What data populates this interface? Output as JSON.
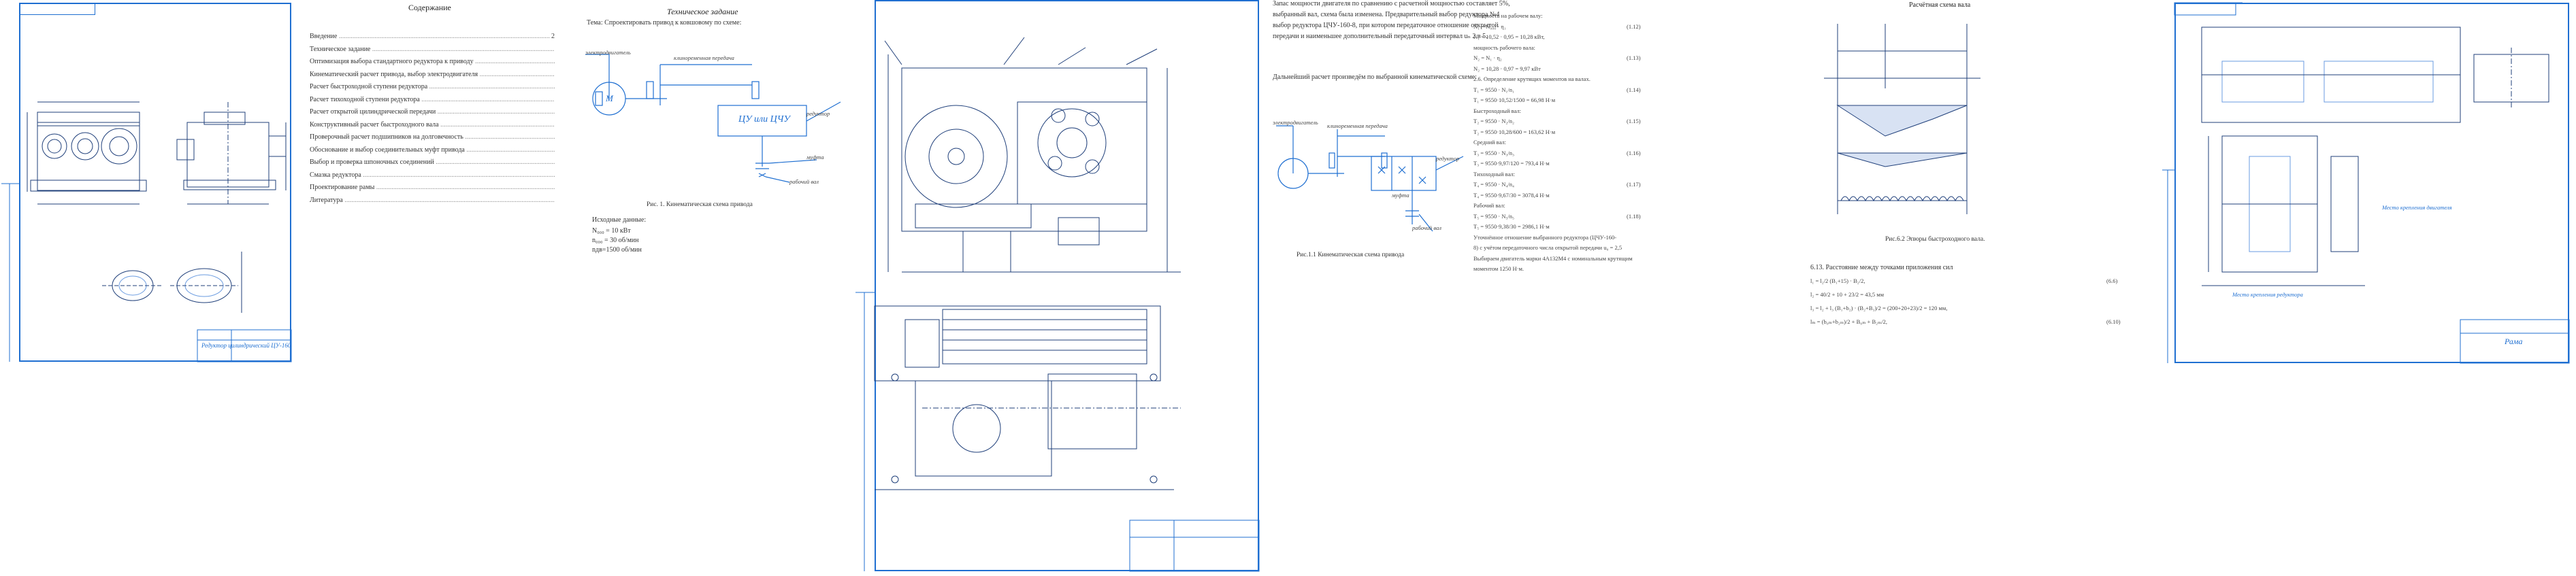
{
  "sheet1": {
    "stamp_title": "Редуктор цилиндрический ЦУ-160"
  },
  "sheet2": {
    "title": "Содержание",
    "items": [
      {
        "label": "Введение",
        "page": "2"
      },
      {
        "label": "Техническое задание",
        "page": ""
      },
      {
        "label": "Оптимизация выбора стандартного редуктора к приводу",
        "page": ""
      },
      {
        "label": "Кинематический расчет привода, выбор электродвигателя",
        "page": ""
      },
      {
        "label": "Расчет быстроходной ступени редуктора",
        "page": ""
      },
      {
        "label": "Расчет тихоходной ступени редуктора",
        "page": ""
      },
      {
        "label": "Расчет открытой цилиндрической передачи",
        "page": ""
      },
      {
        "label": "Конструктивный расчет быстроходного вала",
        "page": ""
      },
      {
        "label": "Проверочный расчет подшипников на долговечность",
        "page": ""
      },
      {
        "label": "Обоснование и выбор соединительных муфт привода",
        "page": ""
      },
      {
        "label": "Выбор и проверка шпоночных соединений",
        "page": ""
      },
      {
        "label": "Смазка редуктора",
        "page": ""
      },
      {
        "label": "Проектирование рамы",
        "page": ""
      },
      {
        "label": "Литература",
        "page": ""
      }
    ]
  },
  "sheet3": {
    "heading": "Техническое задание",
    "theme": "Тема: Спроектировать привод к ковшовому по схеме:",
    "label_motor": "электродвигатель",
    "label_belt": "клиноременная передача",
    "label_gear": "ЦУ или ЦЧУ",
    "label_reducer": "редуктор",
    "label_coupling": "муфта",
    "label_workshaft": "рабочий вал",
    "mark_motor": "М",
    "caption": "Рис. 1. Кинематическая схема привода",
    "initial_heading": "Исходные данные:",
    "initial": [
      "N₀₀₀ = 10 кВт",
      "n₀₀₀ = 30 об/мин",
      "nдв=1500 об/мин"
    ]
  },
  "sheet5": {
    "lines": [
      "Запас мощности двигателя по сравнению с расчетной мощностью составляет 5%,",
      "выбранный вал, схема была изменена. Предварительный выбор редуктора №4",
      "выбор редуктора ЦЧУ-160-8, при котором передаточное отношение открытой",
      "передачи и наименьшее дополнительный передаточный интервал uₙ 2 в 5."
    ],
    "calc_note": "Дальнейший расчет произведём по выбранной кинематической схеме:",
    "label_motor": "электродвигатель",
    "label_belt": "клиноременная передача",
    "label_reducer": "редуктор",
    "label_coupling": "муфта",
    "label_workshaft": "рабочий вал",
    "caption": "Рис.1.1 Кинематическая схема привода",
    "formulas": [
      {
        "text": "Мощность на рабочем валу:",
        "num": ""
      },
      {
        "text": "N₁ = N₀₀₀ · η₁",
        "num": "(1.12)"
      },
      {
        "text": "N₁ = 10,52 · 0,95 = 10,28 кВт,",
        "num": ""
      },
      {
        "text": "мощность рабочего вала:",
        "num": ""
      },
      {
        "text": "N₂ = N₁ · η₂",
        "num": "(1.13)"
      },
      {
        "text": "N₂ = 10,28 · 0,97 = 9,97 кВт",
        "num": ""
      },
      {
        "text": "2.6. Определение крутящих моментов на валах.",
        "num": ""
      },
      {
        "text": "T₁ = 9550 · N₁/n₁",
        "num": "(1.14)"
      },
      {
        "text": "T₁ = 9550·10,52/1500 = 66,98 Н·м",
        "num": ""
      },
      {
        "text": "Быстроходный вал:",
        "num": ""
      },
      {
        "text": "T₂ = 9550 · N₂/n₂",
        "num": "(1.15)"
      },
      {
        "text": "T₂ = 9550·10,28/600 = 163,62 Н·м",
        "num": ""
      },
      {
        "text": "Средний вал:",
        "num": ""
      },
      {
        "text": "T₃ = 9550 · N₃/n₃",
        "num": "(1.16)"
      },
      {
        "text": "T₃ = 9550·9,97/120 = 793,4 Н·м",
        "num": ""
      },
      {
        "text": "Тихоходный вал:",
        "num": ""
      },
      {
        "text": "T₄ = 9550 · N₄/n₄",
        "num": "(1.17)"
      },
      {
        "text": "T₄ = 9550·9,67/30 = 3078,4 Н·м",
        "num": ""
      },
      {
        "text": "Рабочий вал:",
        "num": ""
      },
      {
        "text": "T₅ = 9550 · N₅/n₅",
        "num": "(1.18)"
      },
      {
        "text": "T₅ = 9550·9,38/30 = 2986,1 Н·м",
        "num": ""
      },
      {
        "text": "Уточнённое отношение выбранного редуктора (ЦЧУ-160-",
        "num": ""
      },
      {
        "text": "8) с учётом передаточного числа открытой передачи u₀ = 2,5",
        "num": ""
      },
      {
        "text": "Выбираем двигатель марки 4А132M4 с номинальным крутящим",
        "num": ""
      },
      {
        "text": "моментом 1250 Н·м.",
        "num": ""
      }
    ]
  },
  "sheet6": {
    "heading": "Расчётная схема вала",
    "caption": "Рис.6.2 Эпюры быстроходного вала.",
    "formula_heading": "6.13. Расстояние между точками приложения сил",
    "formulas": [
      {
        "text": "l₁ = l₂/2   (B₁+15) · B₂/2,",
        "num": "(6.6)"
      },
      {
        "text": "l₂ = 40/2 + 10 + 23/2 = 43,5 мм",
        "num": ""
      },
      {
        "text": "l₃ = l₂ + l₃   (B₁+b₂) · (B₂+B₃)/2 = (200+20+23)/2 = 120 мм,",
        "num": ""
      },
      {
        "text": "lₘ = (b₀ₘ+b₂ₘ)/2 + B₀ₘ + B₂ₘ/2,",
        "num": "(6.10)"
      }
    ]
  },
  "sheet7": {
    "label_dims": "Место крепления двигателя",
    "label_bottom": "Место крепления редуктора",
    "stamp_title": "Рама"
  }
}
